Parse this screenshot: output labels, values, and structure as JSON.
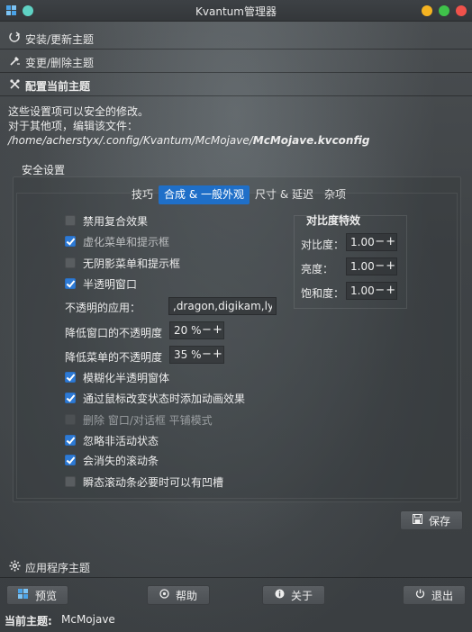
{
  "window": {
    "title": "Kvantum管理器",
    "accent": "#1f6fc8",
    "buttons": {
      "minimize": "#f5b321",
      "maximize": "#3fc24a",
      "close": "#f0524b"
    }
  },
  "sections": {
    "install": {
      "label": "安装/更新主题",
      "icon": "install-theme-icon"
    },
    "change": {
      "label": "变更/删除主题",
      "icon": "change-theme-icon"
    },
    "configure": {
      "label": "配置当前主题",
      "icon": "configure-tools-icon"
    },
    "app_themes": {
      "label": "应用程序主题",
      "icon": "gear-icon"
    }
  },
  "info": {
    "line1": "这些设置项可以安全的修改。",
    "line2": "对于其他项，编辑该文件：",
    "path_prefix": "/home/acherstyx/.config/Kvantum/McMojave/",
    "path_file": "McMojave.kvconfig"
  },
  "safe_settings": {
    "title": "安全设置",
    "tabs": [
      "技巧",
      "合成 & 一般外观",
      "尺寸 & 延迟",
      "杂项"
    ],
    "active_tab": 1
  },
  "options": {
    "disable_composite": {
      "label": "禁用复合效果",
      "checked": false
    },
    "blur_menus": {
      "label": "虚化菜单和提示框",
      "checked": true
    },
    "no_shadow_menus": {
      "label": "无阴影菜单和提示框",
      "checked": false
    },
    "translucent_windows": {
      "label": "半透明窗口",
      "checked": true
    },
    "blur_translucent": {
      "label": "模糊化半透明窗体",
      "checked": true
    },
    "animate_state": {
      "label": "通过鼠标改变状态时添加动画效果",
      "checked": true
    },
    "delete_tile_mode": {
      "label": "删除 窗口/对话框 平铺模式",
      "checked": false
    },
    "ignore_inactive": {
      "label": "忽略非活动状态",
      "checked": true
    },
    "transient_scrollbars": {
      "label": "会消失的滚动条",
      "checked": true
    },
    "transient_groove": {
      "label": "瞬态滚动条必要时可以有凹槽",
      "checked": false
    }
  },
  "fields": {
    "opaque_apps": {
      "label": "不透明的应用：",
      "value": ",dragon,digikam,lyx"
    },
    "window_opacity": {
      "label": "降低窗口的不透明度",
      "value": "20 %"
    },
    "menu_opacity": {
      "label": "降低菜单的不透明度",
      "value": "35 %"
    }
  },
  "contrast": {
    "title": "对比度特效",
    "contrast": {
      "label": "对比度：",
      "value": "1.00"
    },
    "brightness": {
      "label": "亮度：",
      "value": "1.00"
    },
    "saturation": {
      "label": "饱和度：",
      "value": "1.00"
    }
  },
  "buttons": {
    "save": "保存",
    "preview": "预览",
    "help": "帮助",
    "about": "关于",
    "quit": "退出"
  },
  "status": {
    "label": "当前主题:",
    "value": "McMojave"
  },
  "spin_glyphs": {
    "minus": "−",
    "plus": "+"
  }
}
